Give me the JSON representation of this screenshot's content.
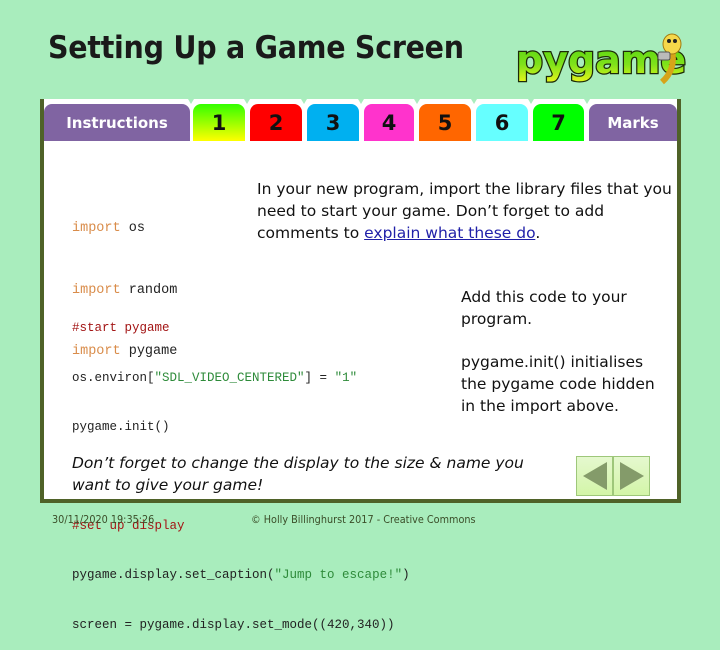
{
  "header": {
    "title": "Setting Up a Game Screen",
    "logo_text": "pygame"
  },
  "tabs": [
    {
      "label": "Instructions",
      "color": "#8064a2",
      "text_color": "#ffffff"
    },
    {
      "label": "1",
      "color": "gradient-green-yellow",
      "gradient": [
        "#33ff00",
        "#ffff00"
      ],
      "text_color": "#111111"
    },
    {
      "label": "2",
      "color": "#ff0000",
      "text_color": "#111111"
    },
    {
      "label": "3",
      "color": "#00b0f0",
      "text_color": "#111111"
    },
    {
      "label": "4",
      "color": "#ff33cc",
      "text_color": "#111111"
    },
    {
      "label": "5",
      "color": "#ff6600",
      "text_color": "#111111"
    },
    {
      "label": "6",
      "color": "#66ffff",
      "text_color": "#111111"
    },
    {
      "label": "7",
      "color": "#00ff00",
      "text_color": "#111111"
    },
    {
      "label": "Marks",
      "color": "#8064a2",
      "text_color": "#ffffff"
    }
  ],
  "content": {
    "imports_code": [
      {
        "keyword": "import",
        "module": "os"
      },
      {
        "keyword": "import",
        "module": "random"
      },
      {
        "keyword": "import",
        "module": "pygame"
      }
    ],
    "intro_text_before_link": "In your new program, import the library files that you need to start your game. Don’t forget to add comments to ",
    "intro_link": "explain what these do",
    "intro_text_after_link": ".",
    "setup_code": {
      "comment1": "#start pygame",
      "line2_prefix": "os.environ[",
      "line2_string": "\"SDL_VIDEO_CENTERED\"",
      "line2_mid": "] = ",
      "line2_value": "\"1\"",
      "line3": "pygame.init()",
      "comment2": "#set up display",
      "line5_prefix": "pygame.display.set_caption(",
      "line5_string": "\"Jump to escape!\"",
      "line5_suffix": ")",
      "line6": "screen = pygame.display.set_mode((420,340))"
    },
    "add_code_text": "Add this code to your program.",
    "init_text": "pygame.init()  initialises the pygame code hidden in the import above.",
    "reminder_text": "Don’t forget to change the display to the size & name you want to give your game!"
  },
  "navigation": {
    "prev_icon": "triangle-left-icon",
    "next_icon": "triangle-right-icon",
    "arrow_color": "#849b6a"
  },
  "footer": {
    "timestamp": "30/11/2020 19:35:26",
    "copyright": "© Holly Billinghurst 2017 - Creative Commons"
  }
}
